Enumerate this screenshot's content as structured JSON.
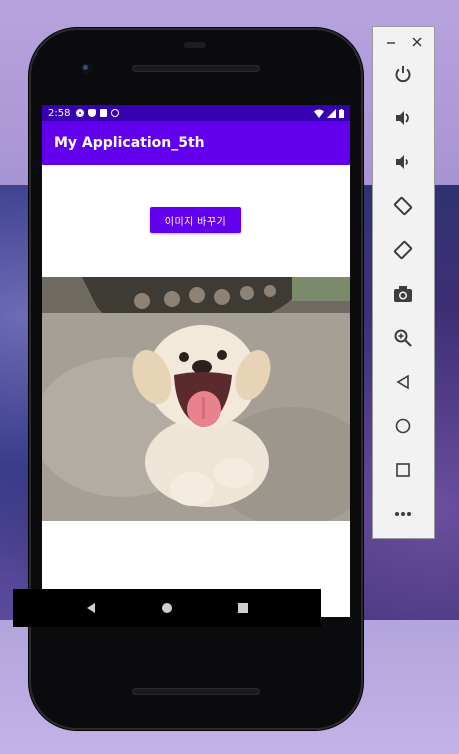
{
  "status_bar": {
    "time": "2:58",
    "left_icons": [
      "gear-icon",
      "shield-icon",
      "sd-card-icon",
      "data-saver-icon"
    ],
    "right_icons": [
      "wifi-icon",
      "signal-icon",
      "battery-icon"
    ]
  },
  "app_bar": {
    "title": "My Application_5th"
  },
  "main": {
    "change_image_button": "이미지 바꾸기",
    "image_alt": "puppy-photo"
  },
  "nav_bar": [
    "back-icon",
    "home-icon",
    "overview-icon"
  ],
  "emulator_panel": {
    "window_controls": [
      "minimize-icon",
      "close-icon"
    ],
    "buttons": [
      "power",
      "volume-up",
      "volume-down",
      "rotate-left",
      "rotate-right",
      "screenshot",
      "zoom",
      "back",
      "home",
      "overview",
      "more"
    ]
  },
  "colors": {
    "status_bar": "#3700b3",
    "app_bar": "#6200ee",
    "button": "#6200ee"
  }
}
